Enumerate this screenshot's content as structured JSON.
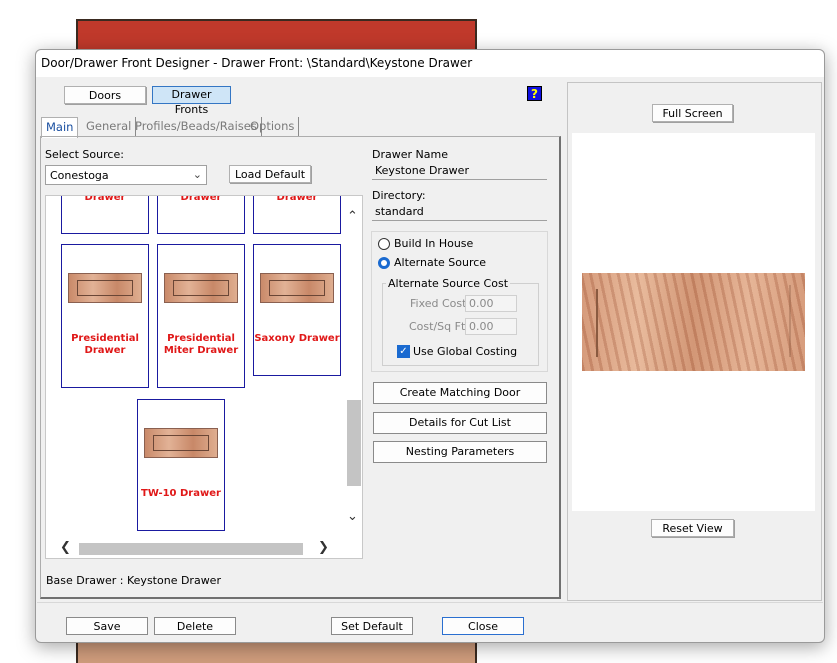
{
  "window": {
    "title": "Door/Drawer Front Designer - Drawer Front: \\Standard\\Keystone Drawer"
  },
  "modes": {
    "doors": "Doors",
    "drawer_fronts": "Drawer Fronts"
  },
  "help": "?",
  "tabs": [
    {
      "label": "Main"
    },
    {
      "label": "General"
    },
    {
      "label": "Profiles/Beads/Raises"
    },
    {
      "label": "Options"
    }
  ],
  "source": {
    "label": "Select Source:",
    "value": "Conestoga",
    "load_default": "Load Default"
  },
  "gallery": {
    "partial_top": [
      "Drawer",
      "Drawer",
      "Drawer"
    ],
    "cards": [
      {
        "title": "Presidential Drawer"
      },
      {
        "title": "Presidential Miter Drawer"
      },
      {
        "title": "Saxony Drawer"
      },
      {
        "title": "TW-10 Drawer"
      }
    ]
  },
  "drawer_name": {
    "label": "Drawer Name",
    "value": "Keystone Drawer"
  },
  "directory": {
    "label": "Directory:",
    "value": "standard"
  },
  "options": {
    "build_in_house": "Build In House",
    "alternate_source": "Alternate Source",
    "alt_cost_group": "Alternate Source Cost",
    "fixed_cost_label": "Fixed Cost",
    "fixed_cost_value": "0.00",
    "cost_sqft_label": "Cost/Sq Ft",
    "cost_sqft_value": "0.00",
    "use_global_costing": "Use Global Costing"
  },
  "actions": {
    "create_matching_door": "Create Matching Door",
    "details_cut_list": "Details for Cut List",
    "nesting_parameters": "Nesting Parameters"
  },
  "base_drawer": "Base Drawer : Keystone Drawer",
  "preview": {
    "full_screen": "Full Screen",
    "reset_view": "Reset View"
  },
  "footer": {
    "save": "Save",
    "delete": "Delete",
    "set_default": "Set Default",
    "close": "Close"
  }
}
